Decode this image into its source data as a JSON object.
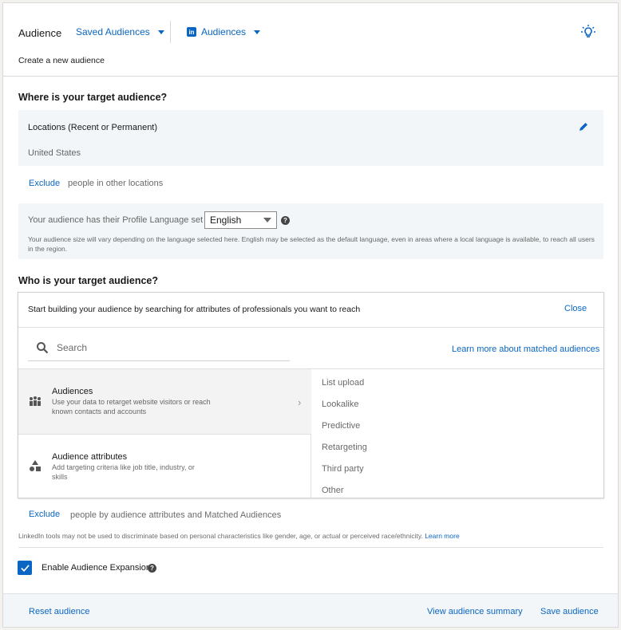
{
  "header": {
    "title": "Audience",
    "saved_audiences_label": "Saved Audiences",
    "audiences_label": "Audiences",
    "subtitle": "Create a new audience",
    "icons": {
      "linkedin": "linkedin-icon",
      "bulb": "lightbulb-icon"
    }
  },
  "where": {
    "title": "Where is your target audience?",
    "locations_label": "Locations (Recent or Permanent)",
    "location_value": "United States",
    "exclude_label": "Exclude",
    "exclude_text": "people in other locations",
    "language_prefix": "Your audience has their Profile Language set to",
    "language_value": "English",
    "language_note": "Your audience size will vary depending on the language selected here. English may be selected as the default language, even in areas where a local language is available, to reach all users in the region."
  },
  "who": {
    "title": "Who is your target audience?",
    "card_header": "Start building your audience by searching for attributes of professionals you want to reach",
    "close_label": "Close",
    "search_placeholder": "Search",
    "learn_more": "Learn more about matched audiences",
    "options": [
      {
        "title": "Audiences",
        "desc": "Use your data to retarget website visitors or reach known contacts and accounts"
      },
      {
        "title": "Audience attributes",
        "desc": "Add targeting criteria like job title, industry, or skills"
      }
    ],
    "sub_items": [
      "List upload",
      "Lookalike",
      "Predictive",
      "Retargeting",
      "Third party",
      "Other"
    ],
    "exclude_label": "Exclude",
    "exclude_text": "people by audience attributes and Matched Audiences",
    "disclaimer": "LinkedIn tools may not be used to discriminate based on personal characteristics like gender, age, or actual or perceived race/ethnicity.",
    "disclaimer_link": "Learn more",
    "expansion_label": "Enable Audience Expansion",
    "expansion_checked": true
  },
  "footer": {
    "reset": "Reset audience",
    "summary": "View audience summary",
    "save": "Save audience"
  },
  "colors": {
    "link": "#0a66c2",
    "panel": "#f3f6f8"
  }
}
